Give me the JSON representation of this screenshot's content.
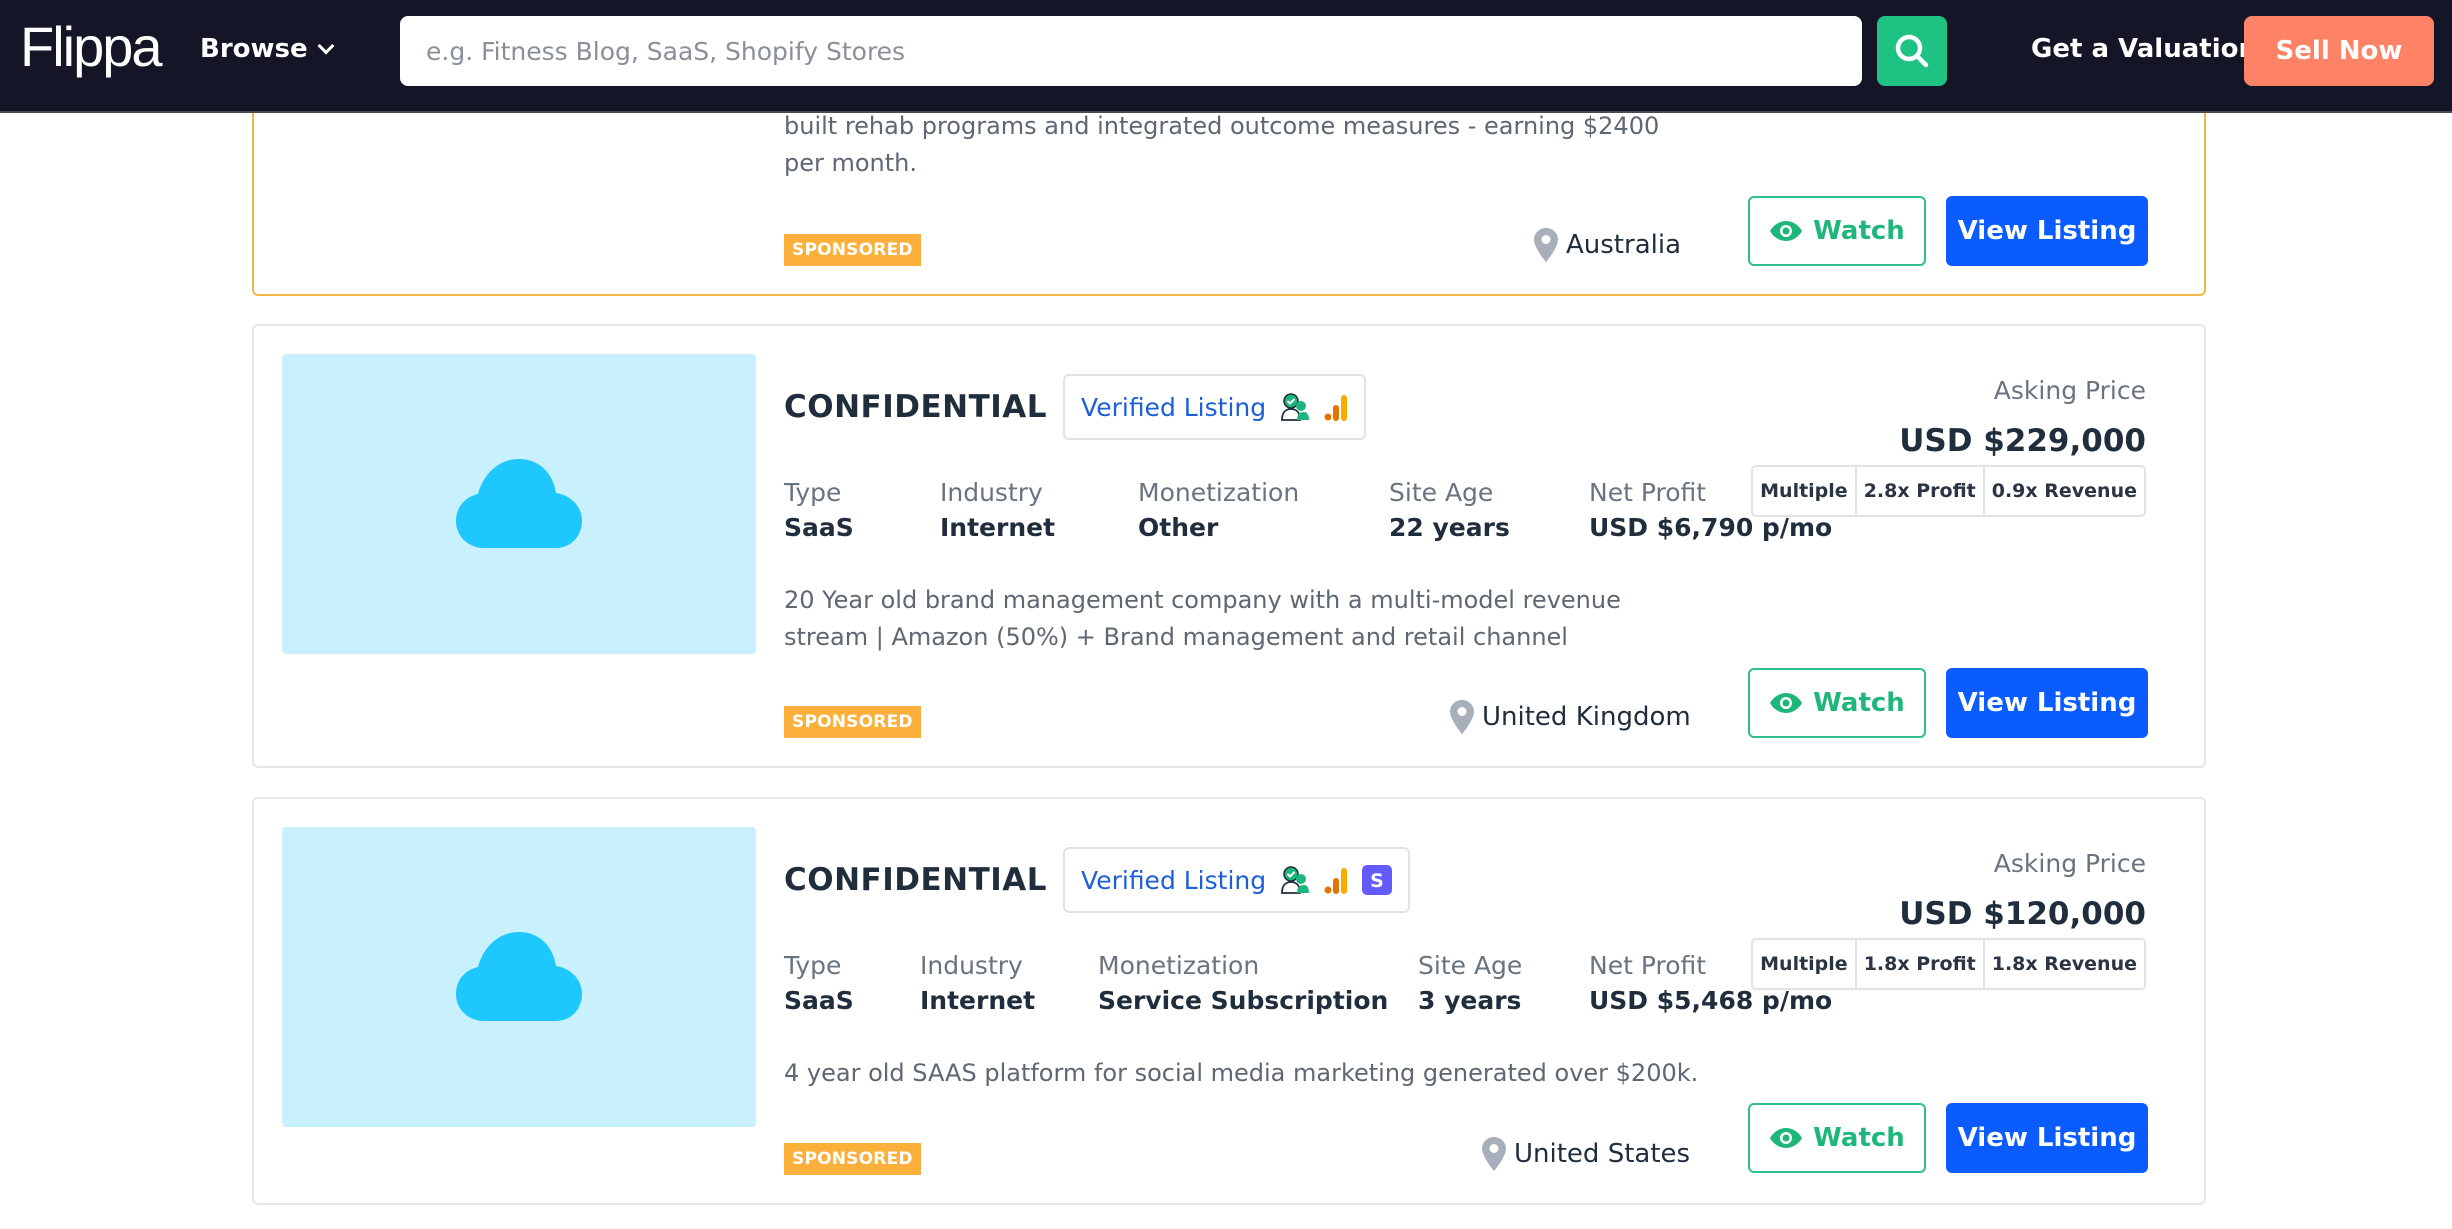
{
  "header": {
    "logo": "Flippa",
    "browse_label": "Browse",
    "search_placeholder": "e.g. Fitness Blog, SaaS, Shopify Stores",
    "search_value": "",
    "valuation_label": "Get a Valuation",
    "sell_label": "Sell Now",
    "icons": {
      "search": "search-icon",
      "browse_caret": "chevron-down-icon"
    },
    "colors": {
      "background": "#141627",
      "search_button": "#1ec384",
      "sell_button": "#fe8366"
    }
  },
  "listings": [
    {
      "featured": true,
      "description": "built rehab programs and integrated outcome measures - earning $2400 per month.",
      "badge": "SPONSORED",
      "location": "Australia",
      "watch_label": "Watch",
      "view_label": "View Listing"
    },
    {
      "title": "CONFIDENTIAL",
      "verified_label": "Verified Listing",
      "verified_icons": [
        "verified-user-icon",
        "google-analytics-icon"
      ],
      "stats": [
        {
          "label": "Type",
          "value": "SaaS"
        },
        {
          "label": "Industry",
          "value": "Internet"
        },
        {
          "label": "Monetization",
          "value": "Other"
        },
        {
          "label": "Site Age",
          "value": "22 years"
        },
        {
          "label": "Net Profit",
          "value": "USD $6,790 p/mo"
        }
      ],
      "asking_label": "Asking Price",
      "asking_price": "USD $229,000",
      "multiples": [
        "Multiple",
        "2.8x Profit",
        "0.9x Revenue"
      ],
      "description": "20 Year old brand management company with a multi-model revenue stream | Amazon (50%) + Brand management and retail channel",
      "badge": "SPONSORED",
      "location": "United Kingdom",
      "watch_label": "Watch",
      "view_label": "View Listing",
      "thumbnail_icon": "cloud-icon"
    },
    {
      "title": "CONFIDENTIAL",
      "verified_label": "Verified Listing",
      "verified_icons": [
        "verified-user-icon",
        "google-analytics-icon",
        "stripe-icon"
      ],
      "stats": [
        {
          "label": "Type",
          "value": "SaaS"
        },
        {
          "label": "Industry",
          "value": "Internet"
        },
        {
          "label": "Monetization",
          "value": "Service Subscription"
        },
        {
          "label": "Site Age",
          "value": "3 years"
        },
        {
          "label": "Net Profit",
          "value": "USD $5,468 p/mo"
        }
      ],
      "asking_label": "Asking Price",
      "asking_price": "USD $120,000",
      "multiples": [
        "Multiple",
        "1.8x Profit",
        "1.8x Revenue"
      ],
      "description": "4 year old SAAS platform for social media marketing generated over $200k.",
      "badge": "SPONSORED",
      "location": "United States",
      "watch_label": "Watch",
      "view_label": "View Listing",
      "thumbnail_icon": "cloud-icon"
    }
  ],
  "colors": {
    "sponsored_badge": "#fbb03b",
    "view_button": "#0b5cff",
    "watch_border": "#2ebf8a",
    "verified_text": "#1d5fd6",
    "thumbnail_bg": "#c9f0fd",
    "cloud": "#1ec8ff",
    "featured_border": "#f2b84a"
  }
}
